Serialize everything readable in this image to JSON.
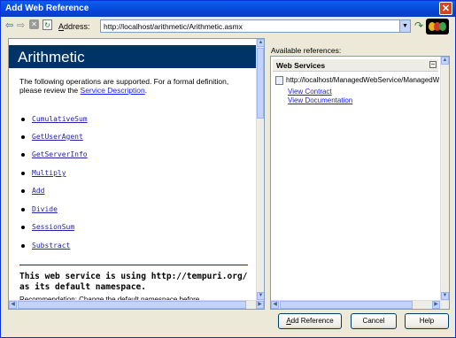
{
  "window": {
    "title": "Add Web Reference",
    "close_icon": "close-icon"
  },
  "toolbar": {
    "back_icon": "back-arrow-icon",
    "forward_icon": "forward-arrow-icon",
    "stop_icon": "stop-icon",
    "refresh_icon": "refresh-icon",
    "address_label_accel": "A",
    "address_label_rest": "ddress:",
    "address_value": "http://localhost/arithmetic/Arithmetic.asmx",
    "go_icon": "go-icon",
    "logo_icon": "vs-logo-icon"
  },
  "browser": {
    "service_name": "Arithmetic",
    "intro_text": "The following operations are supported. For a formal definition, please review the",
    "intro_link": "Service Description",
    "intro_end": ".",
    "operations": [
      "CumulativeSum",
      "GetUserAgent",
      "GetServerInfo",
      "Multiply",
      "Add",
      "Divide",
      "SessionSum",
      "Substract"
    ],
    "namespace_note": "This web service is using http://tempuri.org/ as its default namespace.",
    "cutoff_text": "Recommendation: Change the default namespace before"
  },
  "references": {
    "label": "Available references:",
    "header": "Web Services",
    "url": "http://localhost/ManagedWebService/ManagedWebService.asmx",
    "view_contract": "View Contract",
    "view_documentation": "View Documentation"
  },
  "buttons": {
    "add_reference_accel": "A",
    "add_reference_rest": "dd Reference",
    "cancel": "Cancel",
    "help": "Help"
  },
  "colors": {
    "title_bar": "#0A5FEF",
    "banner": "#003366",
    "link": "#1A1AFF",
    "dialog_bg": "#ECE9D8"
  }
}
